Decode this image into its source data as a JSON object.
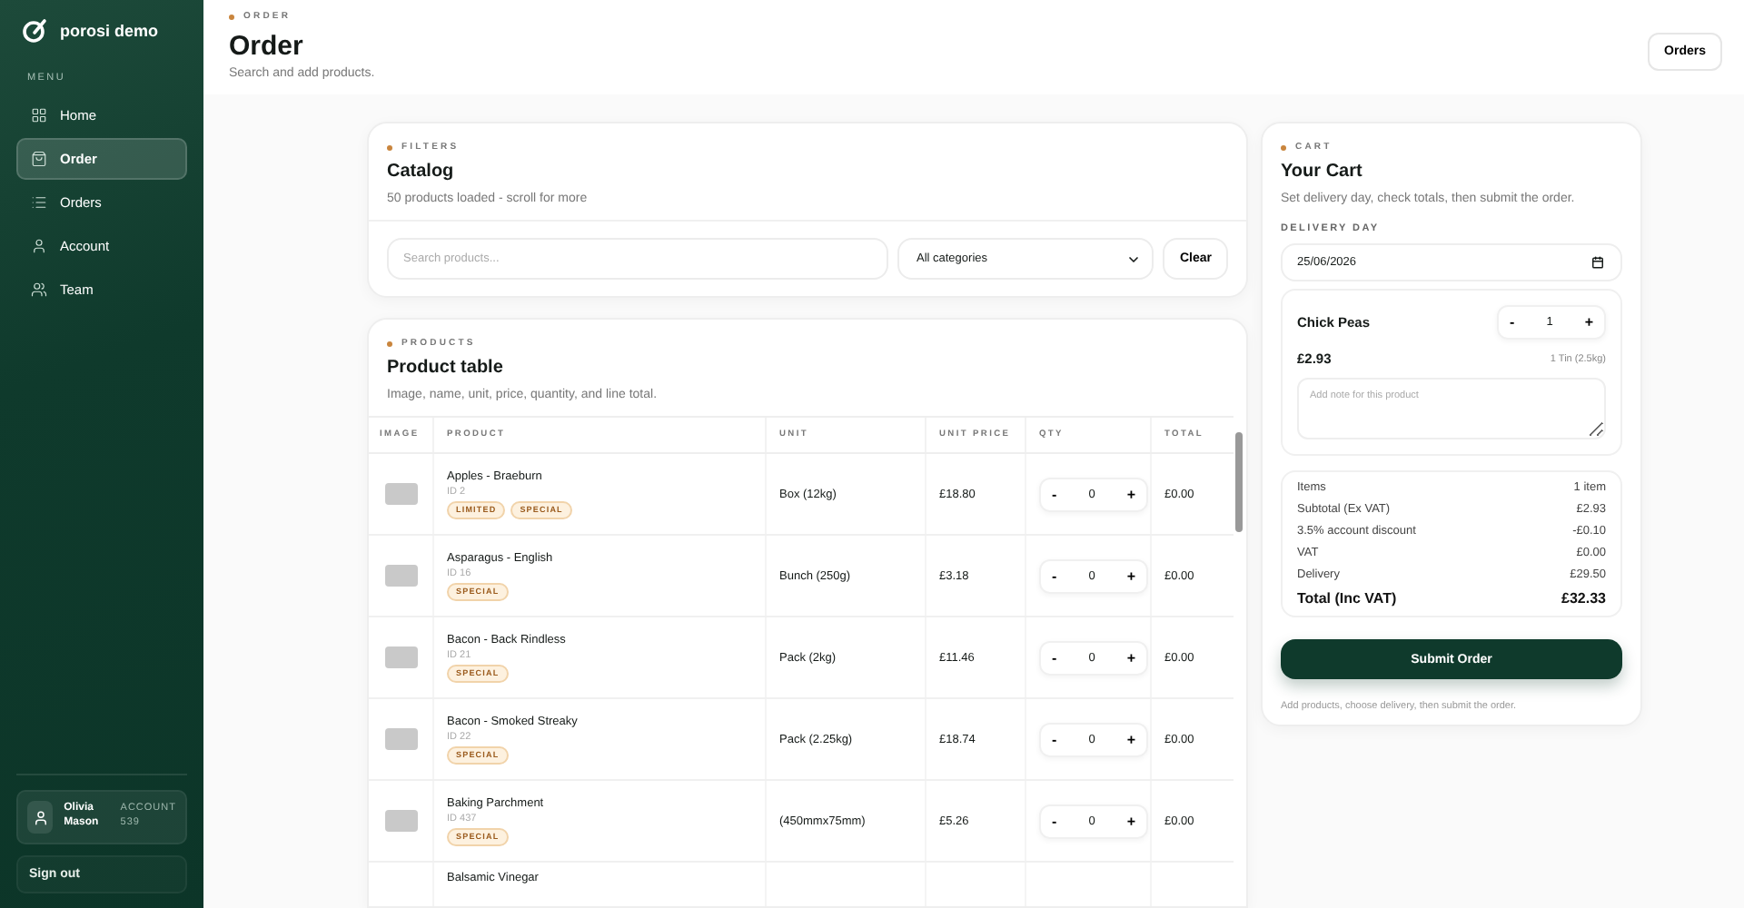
{
  "sidebar": {
    "brand": "porosi demo",
    "menu_label": "MENU",
    "items": [
      {
        "label": "Home",
        "selected": false
      },
      {
        "label": "Order",
        "selected": true
      },
      {
        "label": "Orders",
        "selected": false
      },
      {
        "label": "Account",
        "selected": false
      },
      {
        "label": "Team",
        "selected": false
      }
    ],
    "user": {
      "name": "Olivia Mason",
      "account_label": "ACCOUNT",
      "account_number": "539"
    },
    "sign_out": "Sign out"
  },
  "header": {
    "eyebrow": "ORDER",
    "title": "Order",
    "subtitle": "Search and add products.",
    "button": "Orders"
  },
  "filters": {
    "eyebrow": "FILTERS",
    "title": "Catalog",
    "subtitle": "50 products loaded - scroll for more",
    "search_placeholder": "Search products...",
    "category": "All categories",
    "clear": "Clear"
  },
  "products": {
    "eyebrow": "PRODUCTS",
    "title": "Product table",
    "subtitle": "Image, name, unit, price, quantity, and line total.",
    "columns": [
      "IMAGE",
      "PRODUCT",
      "UNIT",
      "UNIT PRICE",
      "QTY",
      "TOTAL"
    ],
    "rows": [
      {
        "name": "Apples - Braeburn",
        "id": "ID 2",
        "tags": [
          "LIMITED",
          "SPECIAL"
        ],
        "unit": "Box (12kg)",
        "price": "£18.80",
        "decrease": "-",
        "qty": "0",
        "increase": "+",
        "total": "£0.00"
      },
      {
        "name": "Asparagus - English",
        "id": "ID 16",
        "tags": [
          "SPECIAL"
        ],
        "unit": "Bunch (250g)",
        "price": "£3.18",
        "decrease": "-",
        "qty": "0",
        "increase": "+",
        "total": "£0.00"
      },
      {
        "name": "Bacon - Back Rindless",
        "id": "ID 21",
        "tags": [
          "SPECIAL"
        ],
        "unit": "Pack (2kg)",
        "price": "£11.46",
        "decrease": "-",
        "qty": "0",
        "increase": "+",
        "total": "£0.00"
      },
      {
        "name": "Bacon - Smoked Streaky",
        "id": "ID 22",
        "tags": [
          "SPECIAL"
        ],
        "unit": "Pack (2.25kg)",
        "price": "£18.74",
        "decrease": "-",
        "qty": "0",
        "increase": "+",
        "total": "£0.00"
      },
      {
        "name": "Baking Parchment",
        "id": "ID 437",
        "tags": [
          "SPECIAL"
        ],
        "unit": "(450mmx75mm)",
        "price": "£5.26",
        "decrease": "-",
        "qty": "0",
        "increase": "+",
        "total": "£0.00"
      },
      {
        "name": "Balsamic Vinegar"
      }
    ]
  },
  "cart": {
    "eyebrow": "CART",
    "title": "Your Cart",
    "subtitle": "Set delivery day, check totals, then submit the order.",
    "delivery_label": "DELIVERY DAY",
    "date": "25/06/2026",
    "item": {
      "name": "Chick Peas",
      "decrease": "-",
      "qty": "1",
      "increase": "+",
      "price": "£2.93",
      "unit": "1 Tin (2.5kg)",
      "note_placeholder": "Add note for this product"
    },
    "summary": [
      {
        "label": "Items",
        "value": "1 item",
        "kind": "line"
      },
      {
        "label": "Subtotal (Ex VAT)",
        "value": "£2.93",
        "kind": "line"
      },
      {
        "label": "3.5% account discount",
        "value": "-£0.10",
        "kind": "line"
      },
      {
        "label": "VAT",
        "value": "£0.00",
        "kind": "line"
      },
      {
        "label": "Delivery",
        "value": "£29.50",
        "kind": "line"
      },
      {
        "label": "Total (Inc VAT)",
        "value": "£32.33",
        "kind": "total"
      }
    ],
    "submit": "Submit Order",
    "footnote": "Add products, choose delivery, then submit the order."
  }
}
